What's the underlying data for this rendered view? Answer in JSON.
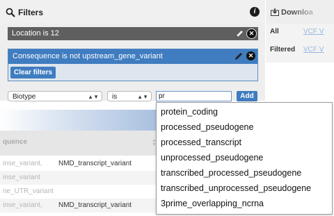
{
  "filters": {
    "title": "Filters",
    "active": [
      "Location is 12",
      "Consequence is not upstream_gene_variant"
    ],
    "clear_label": "Clear filters",
    "field_select": "Biotype",
    "operator_select": "is",
    "input_value": "pr",
    "add_label": "Add"
  },
  "downloads": {
    "title": "Downloa",
    "rows": [
      {
        "label": "All",
        "link": "VCF  V"
      },
      {
        "label": "Filtered",
        "link": "VCF  V"
      }
    ]
  },
  "table": {
    "column_header": "quence",
    "rows": [
      {
        "c1": "inse_variant,",
        "c2": "NMD_transcript_variant"
      },
      {
        "c1": "inse_variant",
        "c2": ""
      },
      {
        "c1": "ne_UTR_variant",
        "c2": ""
      },
      {
        "c1": "inse_variant,",
        "c2": "NMD_transcript_variant"
      }
    ]
  },
  "autocomplete": {
    "options": [
      "protein_coding",
      "processed_pseudogene",
      "processed_transcript",
      "unprocessed_pseudogene",
      "transcribed_processed_pseudogene",
      "transcribed_unprocessed_pseudogene",
      "3prime_overlapping_ncrna"
    ]
  },
  "colors": {
    "accent_blue": "#3f7cc0",
    "active_filter_dark": "#5f5f5f"
  },
  "icons": [
    "search-icon",
    "info-icon",
    "pencil-icon",
    "remove-icon",
    "download-icon",
    "sort-icon"
  ]
}
